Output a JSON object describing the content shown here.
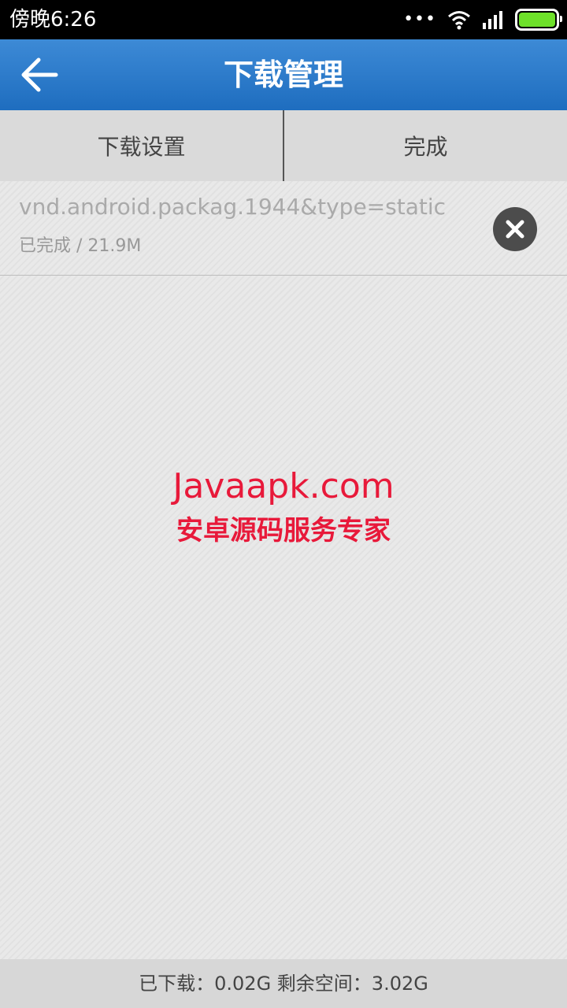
{
  "status_bar": {
    "time": "傍晚6:26",
    "icons": [
      "more-dots-icon",
      "wifi-icon",
      "signal-icon",
      "battery-icon"
    ],
    "battery_color": "#6ee12a"
  },
  "app_bar": {
    "title": "下载管理",
    "back_icon": "arrow-left-icon",
    "background": "#2a79c9"
  },
  "tabs": [
    {
      "label": "下载设置"
    },
    {
      "label": "完成"
    }
  ],
  "downloads": [
    {
      "name": "vnd.android.packag.1944&type=static",
      "status": "已完成 / 21.9M",
      "action_icon": "close-circle-icon"
    }
  ],
  "watermark": {
    "line1": "Javaapk.com",
    "line2": "安卓源码服务专家",
    "color": "#e8193a"
  },
  "footer": {
    "storage_text": "已下载：0.02G 剩余空间：3.02G"
  }
}
